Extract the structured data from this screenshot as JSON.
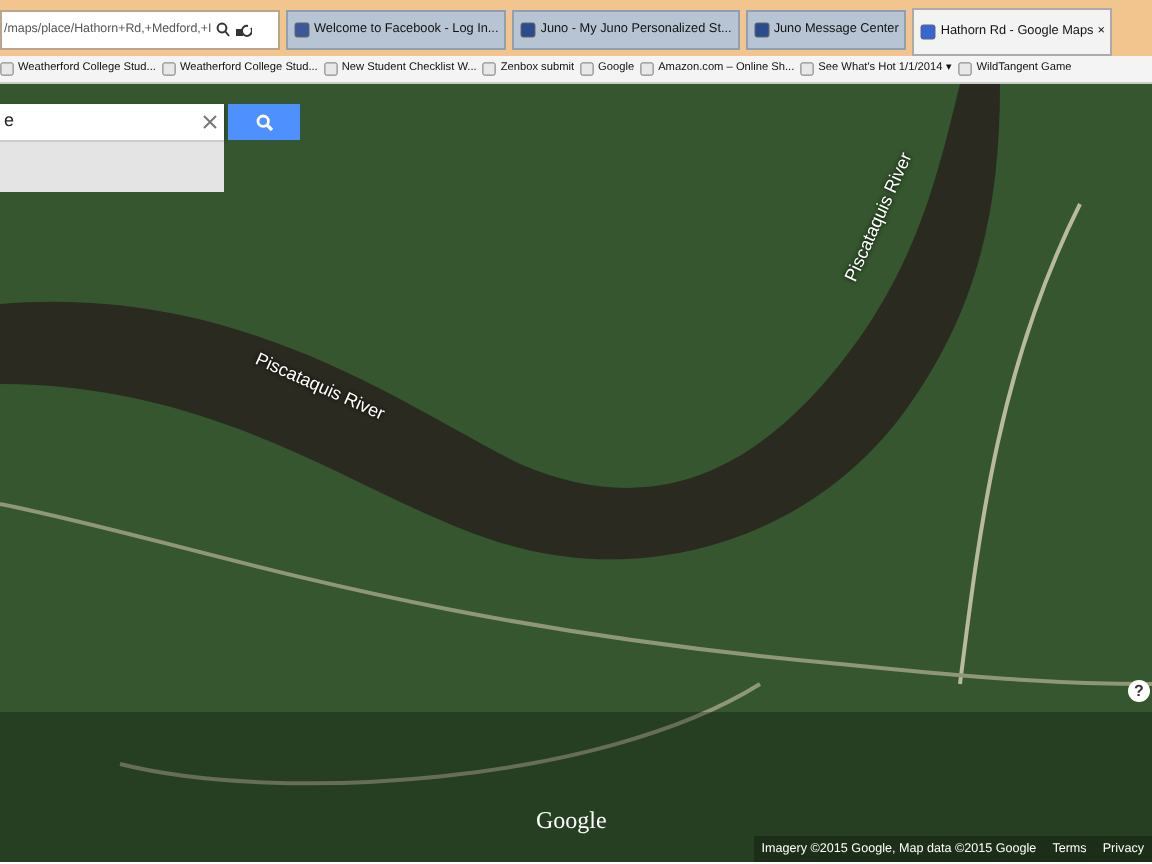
{
  "browser": {
    "address": "/maps/place/Hathorn+Rd,+Medford,+I",
    "tabs": [
      {
        "title": "Welcome to Facebook - Log In...",
        "selected": false
      },
      {
        "title": "Juno - My Juno Personalized St...",
        "selected": false
      },
      {
        "title": "Juno Message Center",
        "selected": false
      },
      {
        "title": "Hathorn Rd - Google Maps",
        "selected": true,
        "close": "×"
      }
    ],
    "bookmarks": [
      {
        "title": "Weatherford College Stud...",
        "kind": "page"
      },
      {
        "title": "Weatherford College Stud...",
        "kind": "page"
      },
      {
        "title": "New Student Checklist  W...",
        "kind": "page"
      },
      {
        "title": "Zenbox submit",
        "kind": "page"
      },
      {
        "title": "Google",
        "kind": "page"
      },
      {
        "title": "Amazon.com – Online Sh...",
        "kind": "page"
      },
      {
        "title": "See What's Hot 1/1/2014",
        "kind": "menu",
        "caret": "▾"
      },
      {
        "title": "WildTangent Game",
        "kind": "page"
      }
    ]
  },
  "map": {
    "search": {
      "value": "e"
    },
    "river_labels": [
      "Piscataquis River",
      "Piscataquis River"
    ],
    "help": "?",
    "logo": "Google",
    "attribution": "Imagery ©2015 Google, Map data ©2015 Google",
    "links": [
      "Terms",
      "Privacy"
    ]
  }
}
